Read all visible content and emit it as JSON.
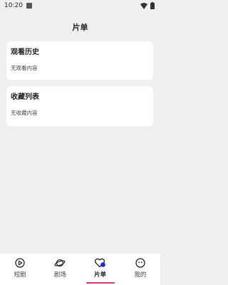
{
  "status_bar": {
    "time": "10:20",
    "icons": [
      "sim-icon",
      "wifi-icon",
      "battery-icon"
    ]
  },
  "header": {
    "title": "片单"
  },
  "history": {
    "title": "观看历史",
    "empty_text": "无观看内容"
  },
  "collection": {
    "title": "收藏列表",
    "empty_text": "无收藏内容"
  },
  "tabbar": {
    "tabs": [
      {
        "label": "短剧",
        "icon": "play-circle-icon",
        "active": false
      },
      {
        "label": "剧场",
        "icon": "planet-icon",
        "active": false
      },
      {
        "label": "片单",
        "icon": "heart-icon",
        "active": true
      },
      {
        "label": "我的",
        "icon": "face-icon",
        "active": false
      }
    ],
    "active_color": "#e0307a",
    "active_icon_color": "#1a2fd8"
  }
}
